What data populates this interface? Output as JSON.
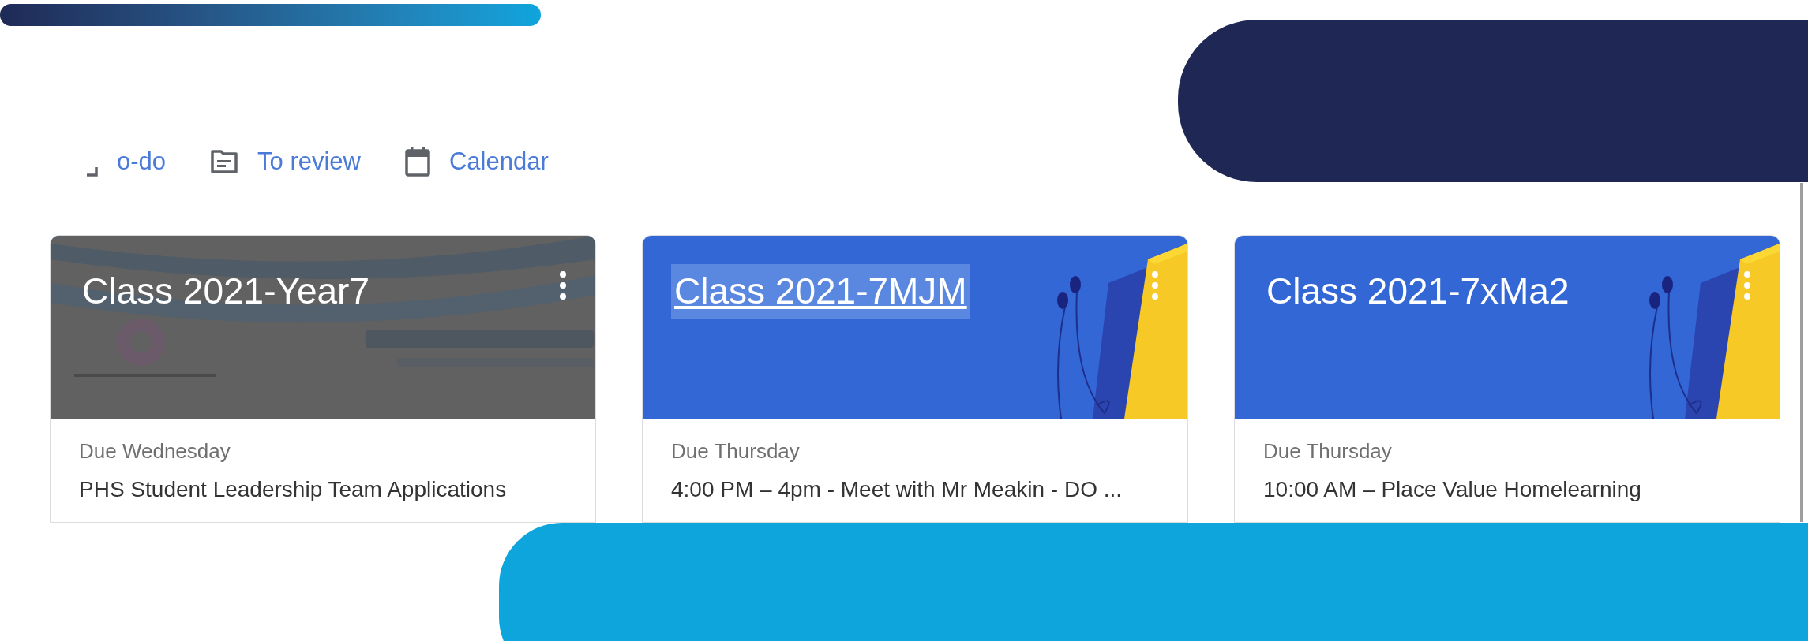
{
  "nav": [
    {
      "kind": "todo",
      "label": "o-do"
    },
    {
      "kind": "review",
      "label": "To review"
    },
    {
      "kind": "calendar",
      "label": "Calendar"
    }
  ],
  "cards": [
    {
      "title": "Class 2021-Year7",
      "highlighted": false,
      "kind": "picture",
      "due": "Due Wednesday",
      "item": "PHS Student Leadership Team Applications"
    },
    {
      "title": "Class 2021-7MJM",
      "highlighted": true,
      "kind": "illustration",
      "due": "Due Thursday",
      "item": "4:00 PM – 4pm - Meet with Mr Meakin - DO ..."
    },
    {
      "title": "Class 2021-7xMa2",
      "highlighted": false,
      "kind": "illustration",
      "due": "Due Thursday",
      "item": "10:00 AM – Place Value Homelearning"
    }
  ]
}
